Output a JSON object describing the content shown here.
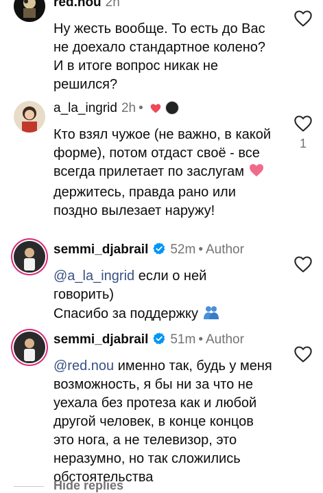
{
  "comments": [
    {
      "username": "red.nou",
      "time": "2h",
      "text": "Ну жесть вообще. То есть до Вас не доехало стандартное колено? И в итоге вопрос никак не решился?"
    },
    {
      "username": "a_la_ingrid",
      "time": "2h",
      "dot": "•",
      "text_before": "Кто взял чужое (не важно, в какой форме), потом отдаст своё - все всегда прилетает по заслугам ",
      "text_after": " держитесь, правда рано или поздно вылезает наружу!",
      "like_count": "1"
    },
    {
      "username": "semmi_djabrail",
      "time": "52m",
      "dot": "•",
      "author_label": "Author",
      "mention": "@a_la_ingrid",
      "text_rest": " если о ней говорить)",
      "text_line2": "Спасибо за поддержку "
    },
    {
      "username": "semmi_djabrail",
      "time": "51m",
      "dot": "•",
      "author_label": "Author",
      "mention": "@red.nou",
      "text_rest": " именно так, будь у меня возможность, я бы ни за что не уехала без протеза как и любой другой человек, в конце концов это нога, а не телевизор, это неразумно, но так сложились обстоятельства"
    }
  ],
  "hide_replies_label": "Hide replies",
  "colors": {
    "mention": "#385185",
    "verified": "#0095f6",
    "heart": "#ed4956",
    "muted": "#737373"
  },
  "icons": [
    "heart-outline-icon",
    "verified-badge-icon",
    "heart-emoji-icon",
    "pink-heart-icon",
    "people-hugging-icon"
  ]
}
